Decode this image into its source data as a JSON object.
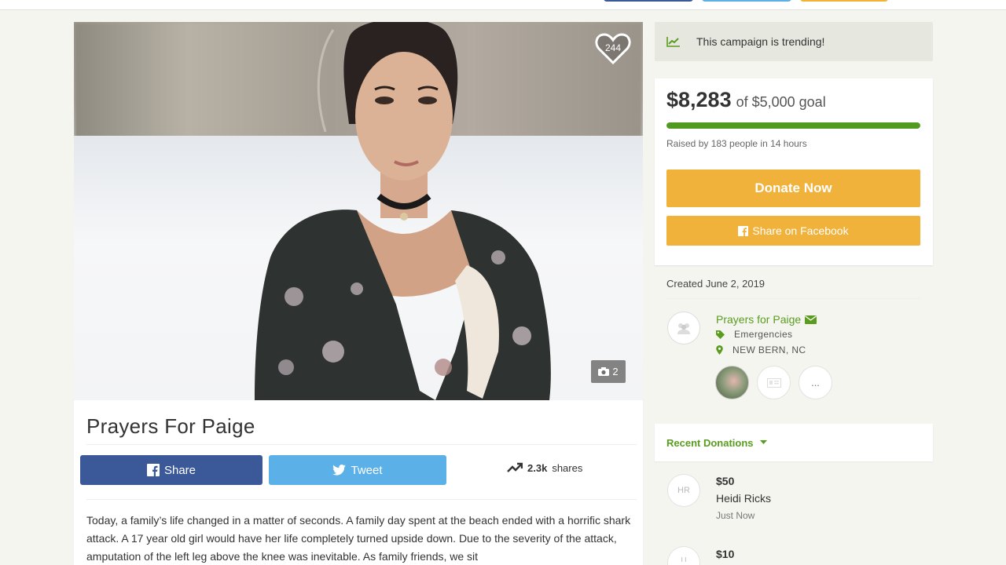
{
  "hero": {
    "like_count": "244",
    "photo_count": "2"
  },
  "campaign": {
    "title": "Prayers For Paige",
    "share_facebook_label": "Share",
    "tweet_label": "Tweet",
    "shares_count": "2.3k",
    "shares_suffix": "shares",
    "story": "Today, a family’s life changed in a matter of seconds. A family day spent at the beach ended with a horrific shark attack. A 17 year old girl would have her life completely turned upside down. Due to the severity of the attack, amputation of the left leg above the knee was inevitable. As family friends, we sit"
  },
  "sidebar": {
    "trending_text": "This campaign is trending!",
    "raised_amount": "$8,283",
    "goal_text": "of $5,000 goal",
    "progress_fraction": 1.0,
    "raised_by": "Raised by 183 people in 14 hours",
    "donate_label": "Donate Now",
    "share_facebook_label": "Share on Facebook",
    "created": "Created June 2, 2019",
    "organizer_name": "Prayers for Paige",
    "category": "Emergencies",
    "location": "NEW BERN, NC",
    "team_more": "...",
    "recent_donations_label": "Recent Donations",
    "donations": [
      {
        "initials": "HR",
        "amount": "$50",
        "name": "Heidi Ricks",
        "time": "Just Now"
      },
      {
        "amount": "$10"
      }
    ]
  },
  "colors": {
    "facebook": "#3b5998",
    "twitter": "#5bb0e8",
    "donate": "#f0b23a",
    "accent_green": "#5a9c1f",
    "progress_green": "#4f9a1f"
  }
}
